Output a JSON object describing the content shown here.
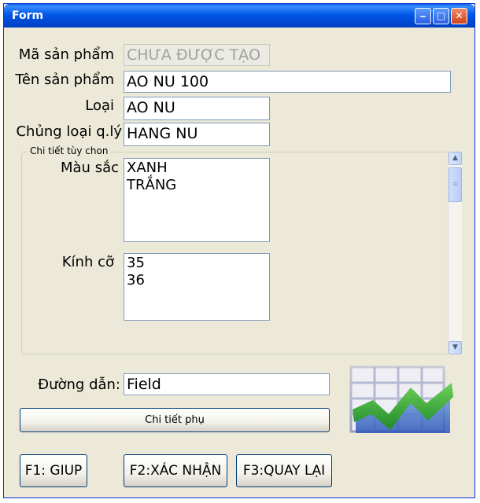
{
  "window": {
    "title": "Form"
  },
  "fields": {
    "ma_san_pham": {
      "label": "Mã sản phẩm",
      "value": "CHƯA ĐƯỢC TẠO"
    },
    "ten_san_pham": {
      "label": "Tên sản phẩm",
      "value": "AO NU 100"
    },
    "loai": {
      "label": "Loại",
      "value": "AO NU"
    },
    "chung_loai": {
      "label": "Chủng loại q.lý",
      "value": "HANG NU"
    }
  },
  "group": {
    "title": "Chi tiết tùy chon",
    "mau_sac": {
      "label": "Màu sắc",
      "items": [
        "XANH",
        "TRẮNG"
      ]
    },
    "kich_co": {
      "label": "Kính cỡ",
      "items": [
        "35",
        "36"
      ]
    }
  },
  "duong_dan": {
    "label": "Đường dẫn:",
    "value": "Field"
  },
  "buttons": {
    "chi_tiet_phu": "Chi tiết phụ",
    "help": "F1: GIUP",
    "confirm": "F2:XÁC NHẬN",
    "back": "F3:QUAY LẠI"
  },
  "colors": {
    "title_bar": "#0055e5",
    "window_bg": "#ece9d8",
    "field_border": "#7f9db9"
  }
}
